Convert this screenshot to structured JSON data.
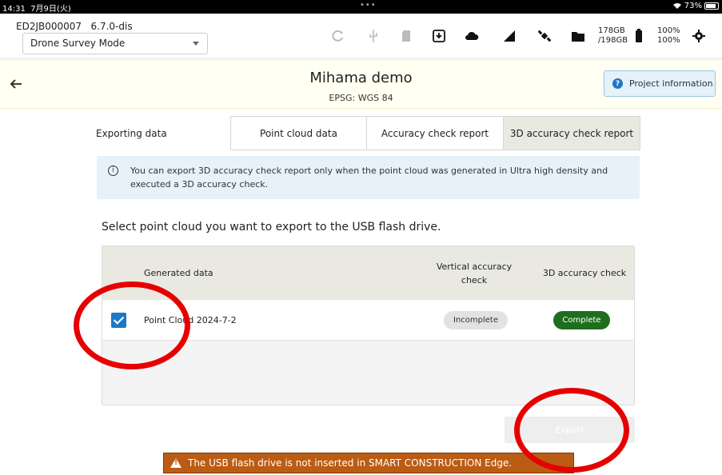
{
  "status_bar": {
    "time": "14:31",
    "date": "7月9日(火)",
    "battery": "73%"
  },
  "device": {
    "id": "ED2JB000007",
    "version": "6.7.0-dis",
    "mode": "Drone Survey Mode",
    "storage_used": "178GB",
    "storage_total": "/198GB",
    "battery_1": "100%",
    "battery_2": "100%"
  },
  "project": {
    "title": "Mihama demo",
    "subtitle": "EPSG: WGS 84",
    "info_button": "Project information"
  },
  "export": {
    "label": "Exporting data",
    "tabs": [
      {
        "label": "Point cloud data",
        "active": false
      },
      {
        "label": "Accuracy check report",
        "active": false
      },
      {
        "label": "3D accuracy check report",
        "active": true
      }
    ],
    "info_text": "You can export 3D accuracy check report only when the point cloud was generated in Ultra high density and executed a 3D accuracy check.",
    "select_heading": "Select point cloud you want to export to the USB flash drive.",
    "table": {
      "headers": [
        "Generated data",
        "Vertical accuracy check",
        "3D accuracy check"
      ],
      "rows": [
        {
          "checked": true,
          "name": "Point Cloud 2024-7-2",
          "vertical": "Incomplete",
          "accuracy_3d": "Complete"
        }
      ]
    },
    "export_button": "Export",
    "warning": "The USB flash drive is not inserted in SMART CONSTRUCTION Edge."
  },
  "colors": {
    "accent": "#1e78c8",
    "complete": "#1e6e1e",
    "warning": "#bb5c14",
    "annotation": "#e60000"
  }
}
